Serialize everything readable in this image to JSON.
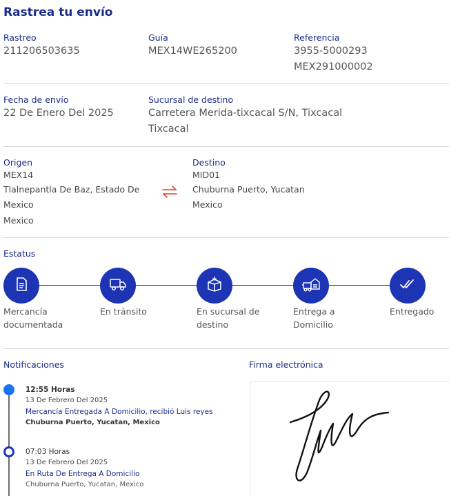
{
  "title": "Rastrea tu envío",
  "tracking": {
    "rastreo_label": "Rastreo",
    "rastreo_value": "211206503635",
    "guia_label": "Guía",
    "guia_value": "MEX14WE265200",
    "referencia_label": "Referencia",
    "referencia_values": [
      "3955-5000293",
      "MEX291000002"
    ]
  },
  "shipping": {
    "fecha_label": "Fecha de envío",
    "fecha_value": "22 De Enero Del 2025",
    "sucursal_label": "Sucursal de destino",
    "sucursal_lines": [
      "Carretera Merida-tixcacal S/N, Tixcacal",
      "Tixcacal"
    ]
  },
  "route": {
    "origen_label": "Origen",
    "origen_code": "MEX14",
    "origen_lines": [
      "Tlalnepantla De Baz, Estado De",
      "Mexico",
      "Mexico"
    ],
    "destino_label": "Destino",
    "destino_code": "MID01",
    "destino_lines": [
      "Chuburna Puerto, Yucatan",
      "Mexico"
    ],
    "swap_icon": "swap-arrows-icon",
    "swap_color": "#e53935"
  },
  "status": {
    "label": "Estatus",
    "steps": [
      {
        "icon": "document-icon",
        "lines": [
          "Mercancía",
          "documentada"
        ]
      },
      {
        "icon": "truck-icon",
        "lines": [
          "En tránsito"
        ]
      },
      {
        "icon": "package-icon",
        "lines": [
          "En sucursal de",
          "destino"
        ]
      },
      {
        "icon": "home-delivery-icon",
        "lines": [
          "Entrega a",
          "Domicilio"
        ]
      },
      {
        "icon": "double-check-icon",
        "lines": [
          "Entregado"
        ]
      }
    ],
    "accent": "#1d35b5"
  },
  "notifications": {
    "label": "Notificaciones",
    "items": [
      {
        "time": "12:55 Horas",
        "date": "13 De Febrero Del 2025",
        "event": "Mercancía Entregada A Domicilio, recibió Luis reyes",
        "place": "Chuburna Puerto, Yucatan, Mexico"
      },
      {
        "time": "07:03 Horas",
        "date": "13 De Febrero Del 2025",
        "event": "En Ruta De Entrega A Domicilio",
        "place": "Chuburna Puerto, Yucatan, Mexico"
      }
    ]
  },
  "signature": {
    "label": "Firma electrónica"
  }
}
